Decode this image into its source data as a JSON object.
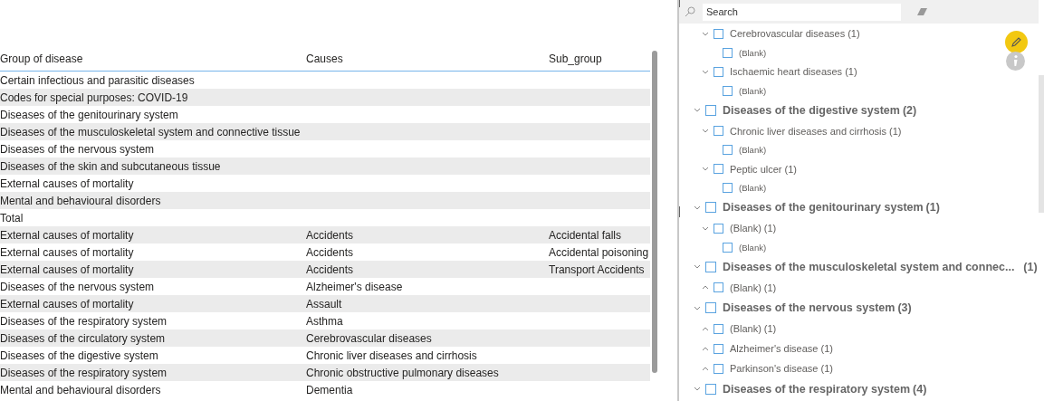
{
  "table": {
    "columns": [
      "Group of disease",
      "Causes",
      "Sub_group"
    ],
    "rows": [
      [
        "Certain infectious and parasitic diseases",
        "",
        ""
      ],
      [
        "Codes for special purposes: COVID-19",
        "",
        ""
      ],
      [
        "Diseases of the genitourinary system",
        "",
        ""
      ],
      [
        "Diseases of the musculoskeletal system and connective tissue",
        "",
        ""
      ],
      [
        "Diseases of the nervous system",
        "",
        ""
      ],
      [
        "Diseases of the skin and subcutaneous tissue",
        "",
        ""
      ],
      [
        "External causes of mortality",
        "",
        ""
      ],
      [
        "Mental and behavioural disorders",
        "",
        ""
      ],
      [
        "Total",
        "",
        ""
      ],
      [
        "External causes of mortality",
        "Accidents",
        "Accidental falls"
      ],
      [
        "External causes of mortality",
        "Accidents",
        "Accidental poisoning"
      ],
      [
        "External causes of mortality",
        "Accidents",
        "Transport Accidents"
      ],
      [
        "Diseases of the nervous system",
        "Alzheimer's disease",
        ""
      ],
      [
        "External causes of mortality",
        "Assault",
        ""
      ],
      [
        "Diseases of the respiratory system",
        "Asthma",
        ""
      ],
      [
        "Diseases of the circulatory system",
        "Cerebrovascular diseases",
        ""
      ],
      [
        "Diseases of the digestive system",
        "Chronic liver diseases and cirrhosis",
        ""
      ],
      [
        "Diseases of the respiratory system",
        "Chronic obstructive pulmonary diseases",
        ""
      ],
      [
        "Mental and behavioural disorders",
        "Dementia",
        ""
      ]
    ]
  },
  "slicer": {
    "search": {
      "placeholder": "Search"
    },
    "continued_children": [
      {
        "label": "Cerebrovascular diseases",
        "count": "(1)",
        "expanded": true,
        "checked": false,
        "children": [
          {
            "label": "(Blank)",
            "checked": false
          }
        ]
      },
      {
        "label": "Ischaemic heart diseases",
        "count": "(1)",
        "expanded": true,
        "checked": false,
        "children": [
          {
            "label": "(Blank)",
            "checked": false
          }
        ]
      }
    ],
    "groups": [
      {
        "label": "Diseases of the digestive system",
        "count": "(2)",
        "expanded": true,
        "checked": false,
        "children": [
          {
            "label": "Chronic liver diseases and cirrhosis",
            "count": "(1)",
            "expanded": true,
            "checked": false,
            "children": [
              {
                "label": "(Blank)",
                "checked": false
              }
            ]
          },
          {
            "label": "Peptic ulcer",
            "count": "(1)",
            "expanded": true,
            "checked": false,
            "children": [
              {
                "label": "(Blank)",
                "checked": false
              }
            ]
          }
        ]
      },
      {
        "label": "Diseases of the genitourinary system",
        "count": "(1)",
        "expanded": true,
        "checked": false,
        "children": [
          {
            "label": "(Blank)",
            "count": "(1)",
            "expanded": true,
            "checked": false,
            "children": [
              {
                "label": "(Blank)",
                "checked": false
              }
            ]
          }
        ]
      },
      {
        "label": "Diseases of the musculoskeletal system and connec...",
        "count": "(1)",
        "expanded": true,
        "checked": false,
        "children": [
          {
            "label": "(Blank)",
            "count": "(1)",
            "expanded": false,
            "checked": false
          }
        ]
      },
      {
        "label": "Diseases of the nervous system",
        "count": "(3)",
        "expanded": true,
        "checked": false,
        "children": [
          {
            "label": "(Blank)",
            "count": "(1)",
            "expanded": false,
            "checked": false
          },
          {
            "label": "Alzheimer's disease",
            "count": "(1)",
            "expanded": false,
            "checked": false
          },
          {
            "label": "Parkinson's disease",
            "count": "(1)",
            "expanded": false,
            "checked": false
          }
        ]
      },
      {
        "label": "Diseases of the respiratory system",
        "count": "(4)",
        "expanded": true,
        "checked": false
      }
    ]
  }
}
